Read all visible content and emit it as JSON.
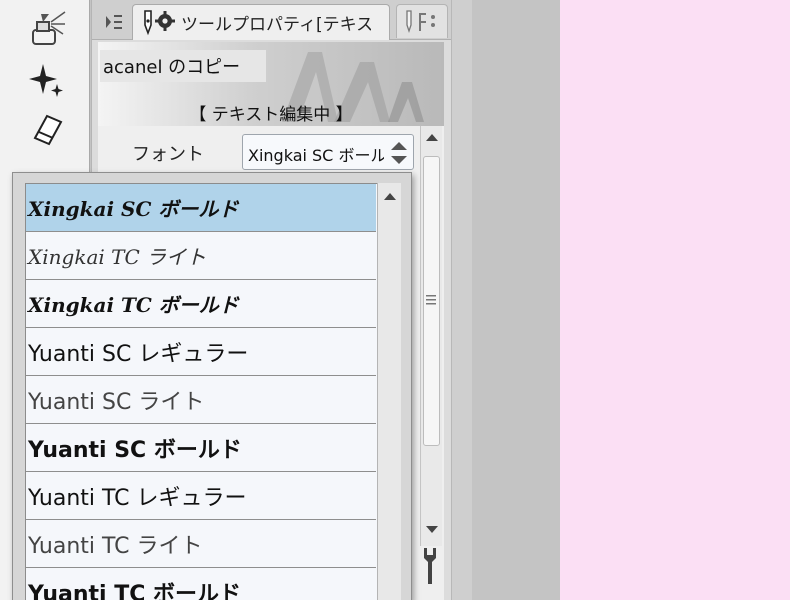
{
  "tab": {
    "title": "ツールプロパティ[テキスト]"
  },
  "preview": {
    "subtool_name": "acanel のコピー",
    "status": "【 テキスト編集中 】"
  },
  "properties": {
    "font_label": "フォント",
    "font_value": "Xingkai SC ボールド"
  },
  "font_list": {
    "selected_index": 0,
    "items": [
      {
        "label": "Xingkai SC ボールド",
        "style": "script-bold"
      },
      {
        "label": "Xingkai TC ライト",
        "style": "script-light"
      },
      {
        "label": "Xingkai TC ボールド",
        "style": "script-bold"
      },
      {
        "label": "Yuanti SC レギュラー",
        "style": "regular"
      },
      {
        "label": "Yuanti SC ライト",
        "style": "light"
      },
      {
        "label": "Yuanti SC ボールド",
        "style": "bold"
      },
      {
        "label": "Yuanti TC レギュラー",
        "style": "regular"
      },
      {
        "label": "Yuanti TC ライト",
        "style": "light"
      },
      {
        "label": "Yuanti TC ボールド",
        "style": "bold"
      }
    ]
  },
  "icons": {
    "tools": [
      "airbrush-icon",
      "sparkle-icon",
      "eraser-icon"
    ],
    "tab_menu": "panel-menu-icon",
    "tab_tool": "pen-gear-icon",
    "scroll_settings": "wrench-icon"
  },
  "colors": {
    "selected_row": "#b0d3ea",
    "desktop_pink": "#fbdff4"
  }
}
